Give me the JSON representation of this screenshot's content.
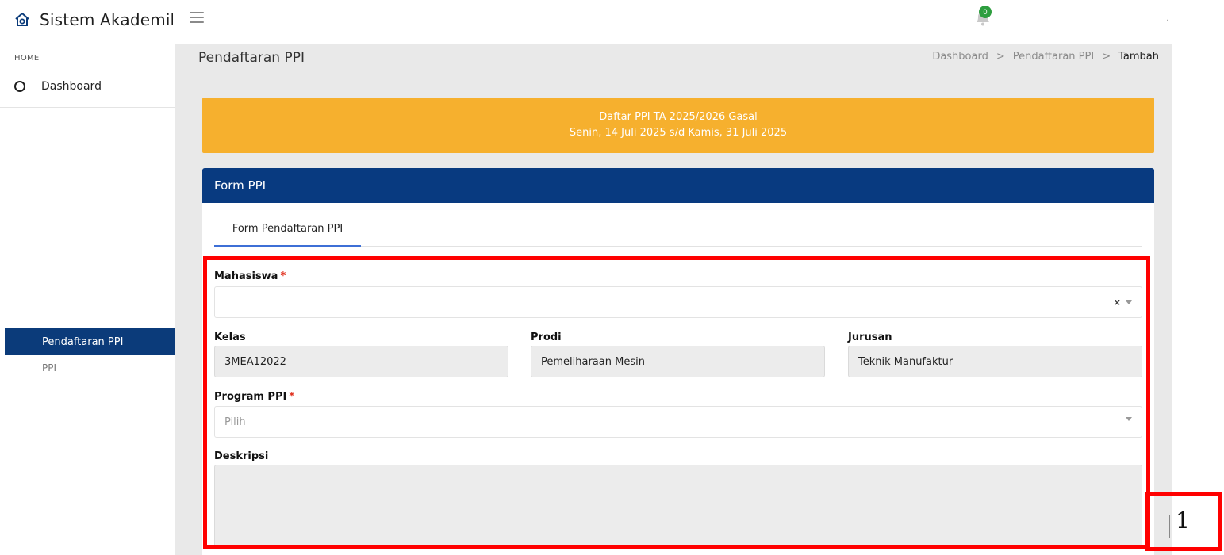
{
  "topbar": {
    "app_title": "Sistem Akademik",
    "brand_icon": "home-logo-icon",
    "menu_icon": "hamburger-icon",
    "notification_icon": "bell-icon",
    "notification_count": "0",
    "user_menu": "."
  },
  "sidebar": {
    "section_label": "HOME",
    "dashboard_label": "Dashboard",
    "dashboard_icon": "circle-icon",
    "active_item_label": "Pendaftaran PPI",
    "sub_item_label": "PPI"
  },
  "page": {
    "title": "Pendaftaran PPI",
    "breadcrumb": [
      "Dashboard",
      "Pendaftaran PPI",
      "Tambah"
    ],
    "breadcrumb_separator": ">"
  },
  "banner": {
    "line1": "Daftar PPI TA 2025/2026 Gasal",
    "line2": "Senin, 14 Juli 2025 s/d Kamis, 31 Juli 2025",
    "color": "#f6b02e"
  },
  "card": {
    "title": "Form PPI",
    "header_color": "#083a80",
    "tab_label": "Form Pendaftaran PPI"
  },
  "form": {
    "mahasiswa": {
      "label": "Mahasiswa",
      "required_mark": "*",
      "value": "",
      "clear_glyph": "×"
    },
    "kelas": {
      "label": "Kelas",
      "value": "3MEA12022"
    },
    "prodi": {
      "label": "Prodi",
      "value": "Pemeliharaan Mesin"
    },
    "jurusan": {
      "label": "Jurusan",
      "value": "Teknik Manufaktur"
    },
    "program_ppi": {
      "label": "Program PPI",
      "required_mark": "*",
      "placeholder": "Pilih"
    },
    "deskripsi": {
      "label": "Deskripsi",
      "value": ""
    }
  },
  "annotation": {
    "number": "1",
    "color": "#ff0000"
  }
}
